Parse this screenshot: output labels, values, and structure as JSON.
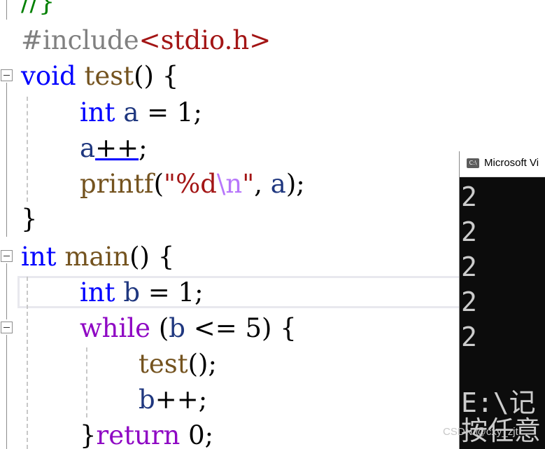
{
  "code": {
    "l0": {
      "comment": "//}"
    },
    "l1": {
      "directive": "#include",
      "header": "<stdio.h>"
    },
    "l2": {
      "kw": "void",
      "fn": "test",
      "rest": "() {"
    },
    "l3": {
      "kw": "int",
      "var": "a",
      "rest": " = 1;"
    },
    "l4": {
      "var": "a",
      "op": "++",
      "rest": ";"
    },
    "l5": {
      "fn": "printf",
      "p1": "(",
      "q1": "\"%d",
      "esc": "\\n",
      "q2": "\"",
      "p2": ", ",
      "var": "a",
      "p3": ");"
    },
    "l6": {
      "rest": "}"
    },
    "l7": {
      "kw": "int",
      "fn": "main",
      "rest": "() {"
    },
    "l8": {
      "kw": "int",
      "var": "b",
      "rest": " = 1;"
    },
    "l9": {
      "kw": "while",
      "p1": " (",
      "var": "b",
      "rest": " <= 5) {"
    },
    "l10": {
      "fn": "test",
      "rest": "();"
    },
    "l11": {
      "var": "b",
      "rest": "++;"
    },
    "l12": {
      "brace": "}",
      "kw": "return",
      "rest": " 0;"
    }
  },
  "console": {
    "title": "Microsoft Vi",
    "output": [
      "2",
      "2",
      "2",
      "2",
      "2"
    ],
    "path_line": "E:\\记",
    "prompt_line": "按任意"
  },
  "watermark": "CSDN @cxy_zjt"
}
